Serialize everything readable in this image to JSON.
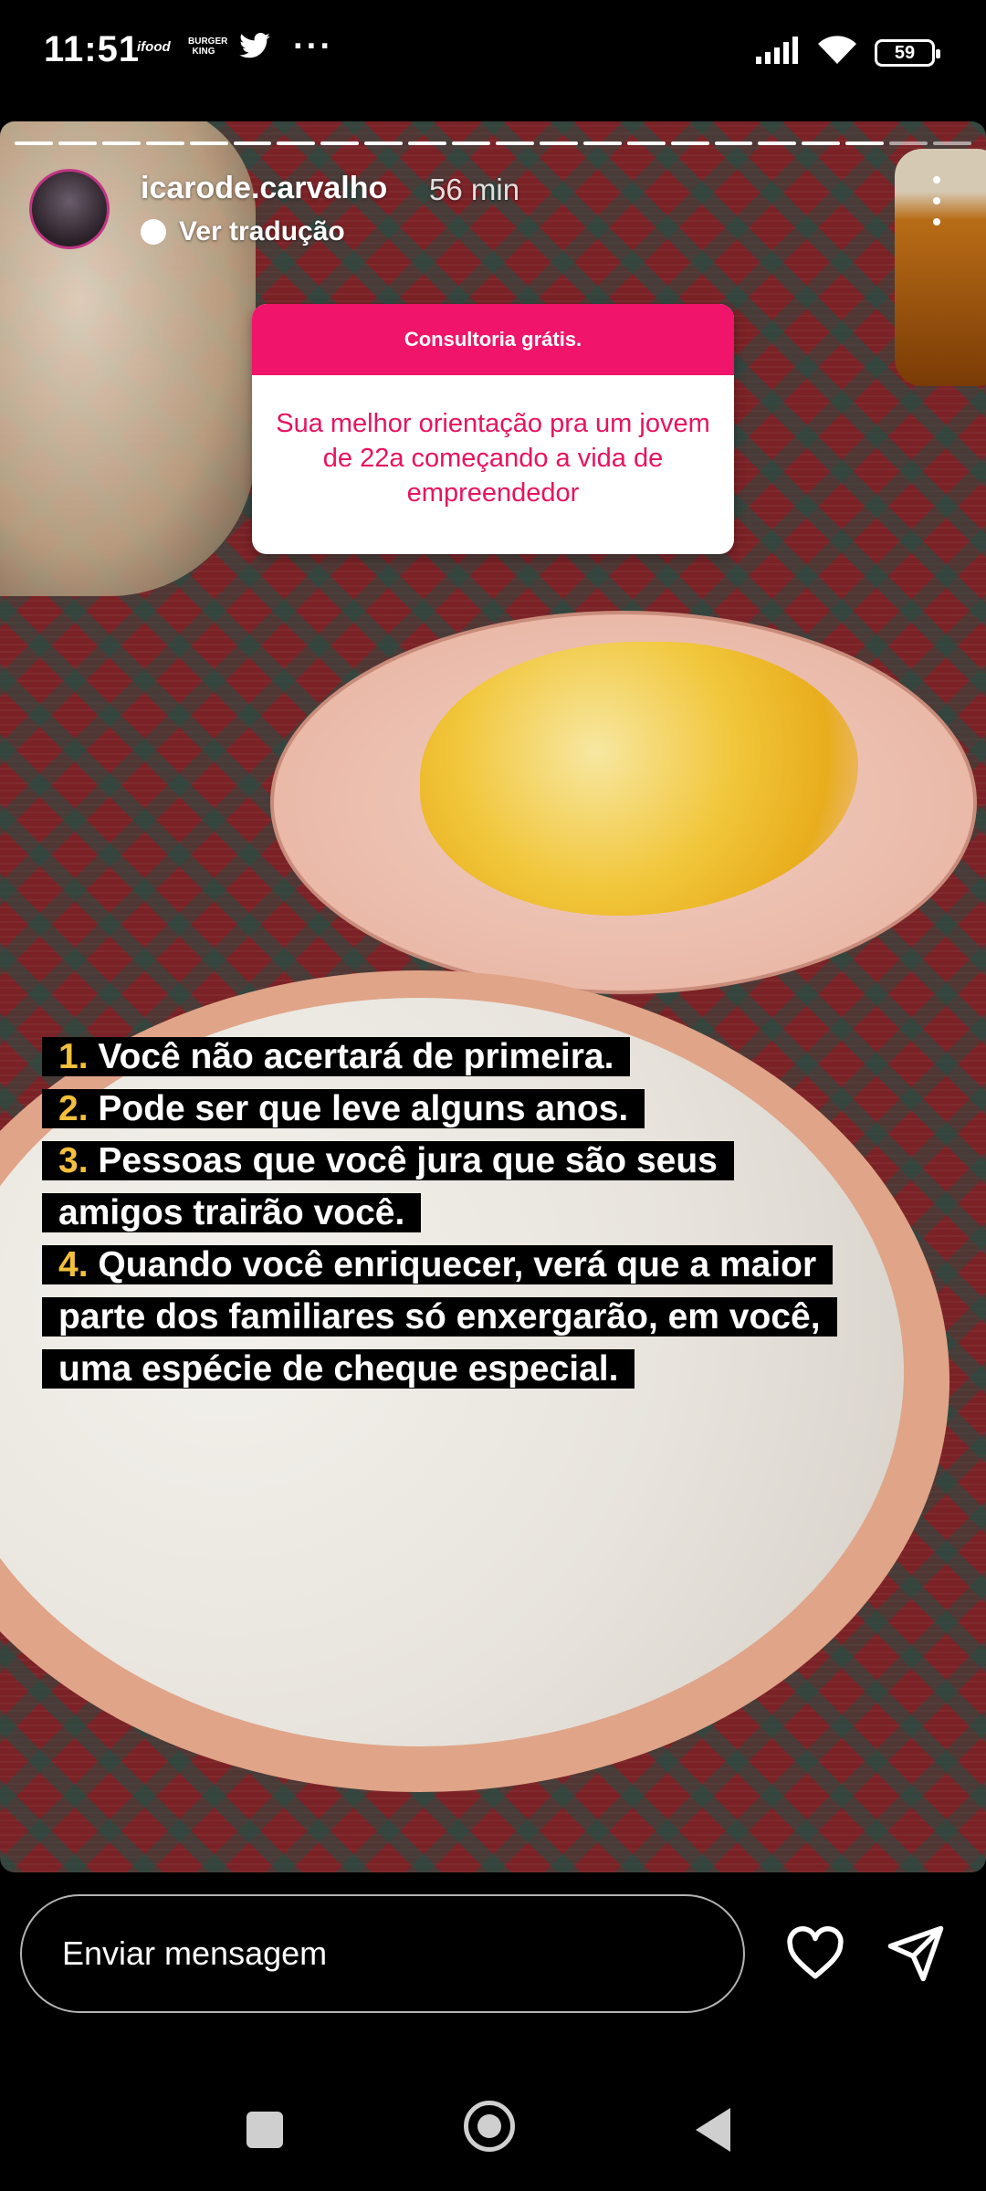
{
  "status_bar": {
    "time": "11:51",
    "notifications": [
      "ifood",
      "BURGER KING",
      "twitter",
      "···"
    ],
    "battery": "59",
    "icons": [
      "signal-icon",
      "wifi-icon",
      "battery-icon"
    ]
  },
  "story": {
    "username": "icarode.carvalho",
    "time_ago": "56 min",
    "translate_label": "Ver tradução",
    "progress_segments": 22,
    "progress_completed": 20
  },
  "question_card": {
    "header": "Consultoria grátis.",
    "question": "Sua melhor orientação pra um jovem de 22a começando a vida de empreendedor",
    "colors": {
      "header_bg": "#f0146a",
      "text": "#e7135f"
    }
  },
  "caption": {
    "items": [
      {
        "number": "1.",
        "lines": [
          "Você não acertará de primeira."
        ]
      },
      {
        "number": "2.",
        "lines": [
          "Pode ser que leve alguns anos."
        ]
      },
      {
        "number": "3.",
        "lines": [
          "Pessoas que você jura que são seus",
          "amigos trairão você."
        ]
      },
      {
        "number": "4.",
        "lines": [
          "Quando você enriquecer, verá que a maior",
          "parte dos familiares só enxergarão, em você,",
          "uma espécie de cheque especial."
        ]
      }
    ],
    "number_color": "#f3bf3c"
  },
  "reply_bar": {
    "placeholder": "Enviar mensagem",
    "icons": [
      "heart-icon",
      "send-icon"
    ]
  },
  "nav_bar": {
    "icons": [
      "recents-icon",
      "home-icon",
      "back-icon"
    ]
  }
}
